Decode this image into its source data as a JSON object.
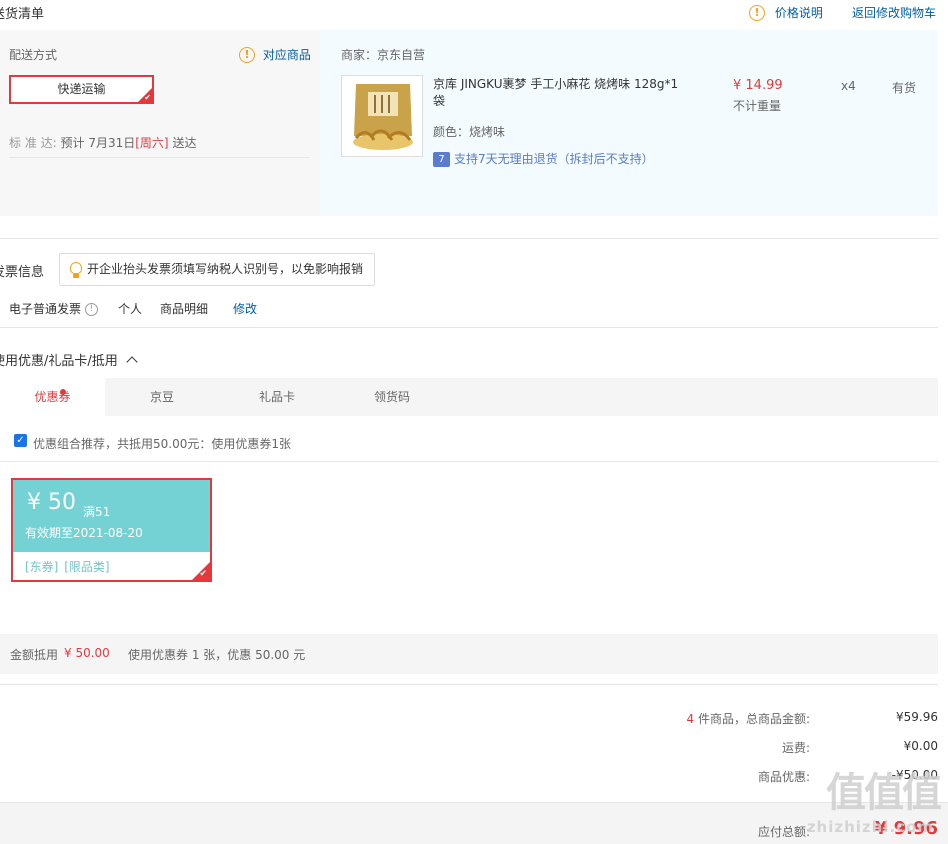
{
  "shipping_list": {
    "title": "送货清单",
    "price_note": "价格说明",
    "back_to_cart": "返回修改购物车",
    "delivery_method_label": "配送方式",
    "matching_products": "对应商品",
    "delivery_option": "快递运输",
    "standard_label": "标 准 达:",
    "estimate_prefix": "预计 7月31日",
    "estimate_day": "[周六]",
    "estimate_suffix": "送达",
    "merchant": "商家：京东自营",
    "product": {
      "name": "京库 JINGKU裹梦 手工小麻花 烧烤味 128g*1袋",
      "color": "颜色：烧烤味",
      "return_policy": "支持7天无理由退货（拆封后不支持）",
      "price": "¥ 14.99",
      "weight_note": "不计重量",
      "quantity": "x4",
      "stock": "有货",
      "img_text": "手工小麻花"
    }
  },
  "invoice": {
    "title": "发票信息",
    "tip": "开企业抬头发票须填写纳税人识别号，以免影响报销",
    "type": "电子普通发票",
    "person": "个人",
    "detail": "商品明细",
    "edit": "修改"
  },
  "discount": {
    "title": "使用优惠/礼品卡/抵用",
    "tabs": [
      {
        "label": "优惠券"
      },
      {
        "label": "京豆"
      },
      {
        "label": "礼品卡"
      },
      {
        "label": "领货码"
      }
    ],
    "recommend_text": "优惠组合推荐，共抵用50.00元：使用优惠券1张",
    "coupon": {
      "amount": "¥ 50",
      "condition": "满51",
      "expiry": "有效期至2021-08-20",
      "tag1": "[东券]",
      "tag2": "[限品类]"
    },
    "summary_label": "金额抵用",
    "summary_amount": "¥ 50.00",
    "summary_detail": "使用优惠券 1 张，优惠 50.00 元"
  },
  "totals": {
    "count": "4",
    "count_suffix": "件商品，总商品金额:",
    "goods_amount": "¥59.96",
    "shipping_label": "运费:",
    "shipping_amount": "¥0.00",
    "discount_label": "商品优惠:",
    "discount_amount": "-¥50.00",
    "payable_label": "应付总额:",
    "payable_amount": "¥ 9.96"
  },
  "watermark": {
    "logo": "值值值",
    "site": "zhizhizhi.com"
  },
  "colors": {
    "accent_red": "#e4393c",
    "link_blue": "#005ea7",
    "coupon_teal": "#74d2d4"
  }
}
